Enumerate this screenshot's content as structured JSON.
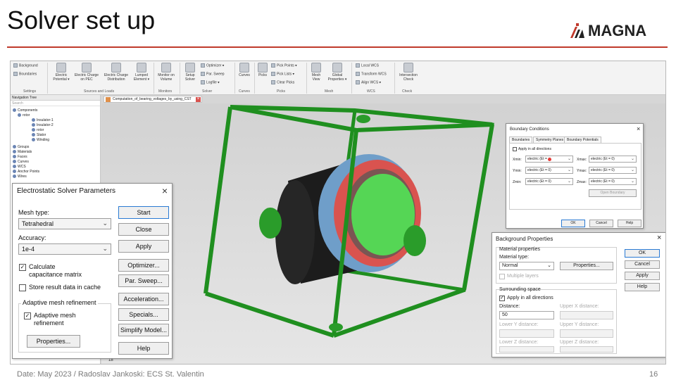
{
  "slide": {
    "title": "Solver set up",
    "logo_text": "MAGNA",
    "footer": "Date: May 2023  / Radoslav Jankoski: ECS St. Valentin",
    "page_number": "16",
    "accent_color": "#c0392b"
  },
  "ribbon": {
    "items": {
      "background": "Background",
      "boundaries": "Boundaries",
      "electric_potential_1": "Electric",
      "electric_potential_2": "Potential ▾",
      "charge_pec_1": "Electric Charge",
      "charge_pec_2": "on PEC",
      "charge_dist_1": "Electric Charge",
      "charge_dist_2": "Distribution",
      "lumped_1": "Lumped",
      "lumped_2": "Element ▾",
      "monitor_1": "Monitor on",
      "monitor_2": "Volume",
      "setup_1": "Setup",
      "setup_2": "Solver",
      "optimizer": "Optimizer ▾",
      "par_sweep": "Par. Sweep",
      "logfile": "Logfile ▾",
      "curves": "Curves",
      "picks": "Picks",
      "pick_points": "Pick Points ▾",
      "pick_lists": "Pick Lists ▾",
      "clear_picks": "Clear Picks",
      "mesh_view_1": "Mesh",
      "mesh_view_2": "View",
      "global_props_1": "Global",
      "global_props_2": "Properties ▾",
      "local_wcs": "Local WCS",
      "transform_wcs": "Transform WCS",
      "align_wcs": "Align WCS ▾",
      "intersection_1": "Intersection",
      "intersection_2": "Check"
    },
    "groups": {
      "settings": "Settings",
      "sources": "Sources and Loads",
      "monitors": "Monitors",
      "solver": "Solver",
      "curves": "Curves",
      "picks": "Picks",
      "mesh": "Mesh",
      "wcs": "WCS",
      "check": "Check"
    }
  },
  "nav_tree": {
    "title": "Navigation Tree",
    "search": "Search",
    "rows": [
      "Components",
      "rotor",
      "Insulator-1",
      "Insulator-2",
      "rotor",
      "Stator",
      "Winding",
      "Groups",
      "Materials",
      "Faces",
      "Curves",
      "WCS",
      "Anchor Points",
      "Wires"
    ]
  },
  "doc_tab": {
    "label": "Computation_of_bearing_voltages_by_using_CST"
  },
  "viewport": {
    "axis_value": "18"
  },
  "es_dialog": {
    "title": "Electrostatic Solver Parameters",
    "mesh_type_label": "Mesh type:",
    "mesh_type_value": "Tetrahedral",
    "accuracy_label": "Accuracy:",
    "accuracy_value": "1e-4",
    "calc_cap_1": "Calculate",
    "calc_cap_2": "capacitance matrix",
    "calc_cap_checked": "✓",
    "store_cache": "Store result data in cache",
    "adaptive_group": "Adaptive mesh refinement",
    "adaptive_1": "Adaptive mesh",
    "adaptive_2": "refinement",
    "adaptive_checked": "✓",
    "properties": "Properties...",
    "buttons": [
      "Start",
      "Close",
      "Apply",
      "Optimizer...",
      "Par. Sweep...",
      "Acceleration...",
      "Specials...",
      "Simplify Model...",
      "Help"
    ]
  },
  "bc_dialog": {
    "title": "Boundary Conditions",
    "tabs": [
      "Boundaries",
      "Symmetry Planes",
      "Boundary Potentials"
    ],
    "apply_all": "Apply in all directions",
    "rows": [
      {
        "min_label": "Xmin:",
        "min_value": "electric (Et = 0)",
        "max_label": "Xmax:",
        "max_value": "electric (Et = 0)"
      },
      {
        "min_label": "Ymin:",
        "min_value": "electric (Et = 0)",
        "max_label": "Ymax:",
        "max_value": "electric (Et = 0)"
      },
      {
        "min_label": "Zmin:",
        "min_value": "electric (Et = 0)",
        "max_label": "Zmax:",
        "max_value": "electric (Et = 0)"
      }
    ],
    "open_boundary": "Open Boundary",
    "ok": "OK",
    "cancel": "Cancel",
    "help": "Help"
  },
  "bg_dialog": {
    "title": "Background Properties",
    "material_group": "Material properties",
    "material_type_label": "Material type:",
    "material_type_value": "Normal",
    "properties": "Properties...",
    "multiple_layers": "Multiple layers",
    "surrounding_group": "Surrounding space",
    "apply_all": "Apply in all directions",
    "apply_all_checked": "✓",
    "distance_label": "Distance:",
    "distance_value": "50",
    "upper_x": "Upper X distance:",
    "lower_y": "Lower Y distance:",
    "upper_y": "Upper Y distance:",
    "lower_z": "Lower Z distance:",
    "upper_z": "Upper Z distance:",
    "buttons": [
      "OK",
      "Cancel",
      "Apply",
      "Help"
    ]
  }
}
